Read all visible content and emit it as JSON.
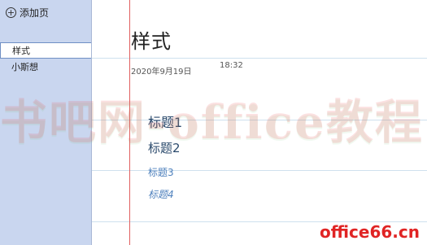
{
  "sidebar": {
    "add_page_label": "添加页",
    "pages": [
      {
        "label": "样式",
        "selected": true
      },
      {
        "label": "小斯想",
        "selected": false
      }
    ]
  },
  "page": {
    "title": "样式",
    "date": "2020年9月19日",
    "time": "18:32",
    "headings": [
      {
        "label": "标题1",
        "level": 1
      },
      {
        "label": "标题2",
        "level": 2
      },
      {
        "label": "标题3",
        "level": 3
      },
      {
        "label": "标题4",
        "level": 4
      }
    ]
  },
  "watermark": {
    "text": "书吧网-office教程网",
    "logo": "office66.cn"
  },
  "colors": {
    "sidebar_bg": "#c9d6ef",
    "margin_line": "#e06060",
    "heading_dark": "#2b4a6c",
    "heading_blue": "#4f81bd"
  }
}
